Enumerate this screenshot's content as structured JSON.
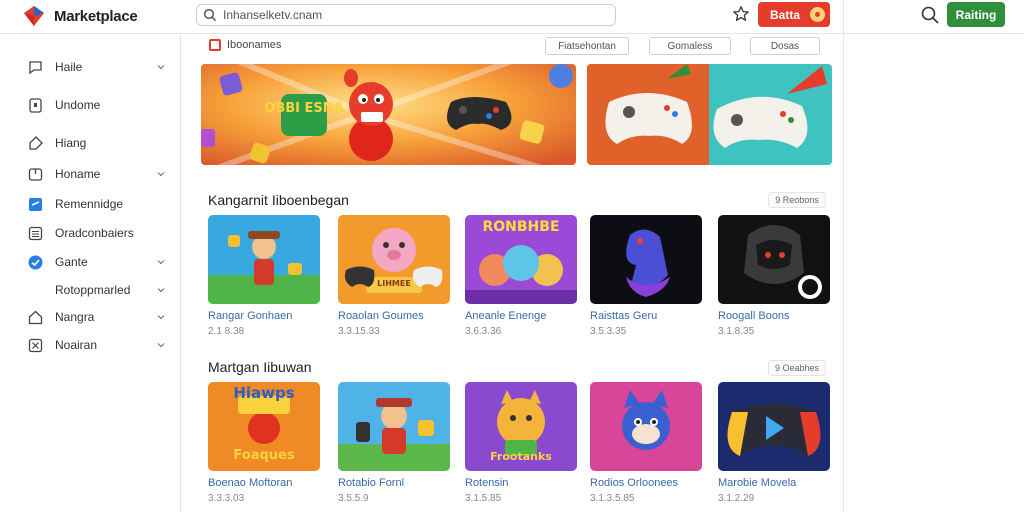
{
  "header": {
    "app_name": "Marketplace",
    "search_value": "Inhanselketv.cnam",
    "red_button_label": "Batta",
    "green_button_label": "Raiting"
  },
  "sidebar": {
    "items": [
      {
        "label": "Haile",
        "icon": "chat-icon",
        "has_chevron": true
      },
      {
        "label": "Undome",
        "icon": "device-icon",
        "has_chevron": false
      },
      {
        "label": "Hiang",
        "icon": "tag-icon",
        "has_chevron": false
      },
      {
        "label": "Honame",
        "icon": "box-icon",
        "has_chevron": true
      },
      {
        "label": "Remennidge",
        "icon": "folder-icon",
        "has_chevron": false
      },
      {
        "label": "Oradconbaiers",
        "icon": "list-icon",
        "has_chevron": false
      },
      {
        "label": "Gante",
        "icon": "check-circle-icon",
        "has_chevron": true
      },
      {
        "label": "Rotoppmarled",
        "icon": "",
        "has_chevron": true
      },
      {
        "label": "Nangra",
        "icon": "home-icon",
        "has_chevron": true
      },
      {
        "label": "Noairan",
        "icon": "grid-icon",
        "has_chevron": true
      }
    ]
  },
  "main": {
    "section_tag": "Iboonames",
    "filters": [
      "Fiatsehontan",
      "Gomaless",
      "Dosas"
    ],
    "banner_left_text": "OBBI ESNA",
    "sections": [
      {
        "title": "Kangarnit Iiboenbegan",
        "see_all": "9 Reobons",
        "cards": [
          {
            "title": "Rangar Gonhaen",
            "meta": "2.1 8.38"
          },
          {
            "title": "Roaolan Goumes",
            "meta": "3.3.15.33",
            "art_text": "LIHMEE"
          },
          {
            "title": "Aneanle Enenge",
            "meta": "3.6.3.36",
            "art_text": "RONBHBE"
          },
          {
            "title": "Raisttas Geru",
            "meta": "3.5.3.35"
          },
          {
            "title": "Roogall Boons",
            "meta": "3.1.8.35"
          }
        ]
      },
      {
        "title": "Martgan Iibuwan",
        "see_all": "9 Oeabhes",
        "cards": [
          {
            "title": "Boenao Moftoran",
            "meta": "3.3.3.03",
            "art_text": "Hiawps",
            "art_text_2": "Foaques"
          },
          {
            "title": "Rotabio Fornl",
            "meta": "3.5.5.9"
          },
          {
            "title": "Rotensin",
            "meta": "3.1.5.85",
            "art_text": "Frootanks"
          },
          {
            "title": "Rodios Orloonees",
            "meta": "3.1.3.5.85"
          },
          {
            "title": "Marobie Movela",
            "meta": "3.1.2.29"
          }
        ]
      }
    ]
  },
  "colors": {
    "accent_red": "#e53c2c",
    "accent_green": "#2f8f3a",
    "link_blue": "#3a6aa8"
  }
}
